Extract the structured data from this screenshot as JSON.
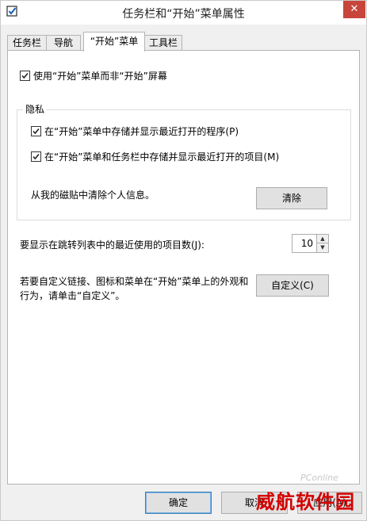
{
  "window": {
    "title": "任务栏和“开始”菜单属性",
    "close_icon": "close-icon",
    "app_icon": "checkbox-window-icon"
  },
  "tabs": [
    {
      "label": "任务栏",
      "active": false
    },
    {
      "label": "导航",
      "active": false
    },
    {
      "label": "“开始”菜单",
      "active": true
    },
    {
      "label": "工具栏",
      "active": false
    }
  ],
  "start_menu": {
    "use_start_menu_label": "使用“开始”菜单而非“开始”屏幕",
    "use_start_menu_checked": true
  },
  "privacy": {
    "legend": "隐私",
    "store_programs_label": "在“开始”菜单中存储并显示最近打开的程序(P)",
    "store_programs_checked": true,
    "store_items_label": "在“开始”菜单和任务栏中存储并显示最近打开的项目(M)",
    "store_items_checked": true,
    "clear_text": "从我的磁贴中清除个人信息。",
    "clear_button": "清除"
  },
  "jump_list": {
    "label": "要显示在跳转列表中的最近使用的项目数(J):",
    "value": "10"
  },
  "customize": {
    "text_line1": "若要自定义链接、图标和菜单在“开始”菜单上的外观和",
    "text_line2": "行为，请单击“自定义”。",
    "button": "自定义(C)"
  },
  "footer": {
    "ok": "确定",
    "cancel": "取消",
    "apply": "应用(A)"
  },
  "watermark": {
    "text": "威航软件园",
    "brand": "PConline"
  }
}
